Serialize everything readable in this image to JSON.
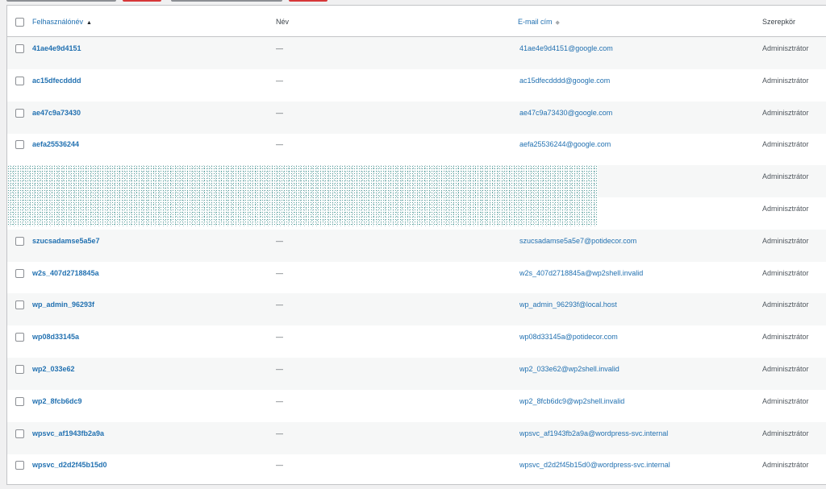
{
  "colors": {
    "link": "#2271b1",
    "danger": "#d63638",
    "border": "#c3c4c7",
    "alt_row": "#f6f7f7"
  },
  "header": {
    "username": "Felhasználónév",
    "name": "Név",
    "email": "E-mail cím",
    "role": "Szerepkör"
  },
  "rows": [
    {
      "username": "41ae4e9d4151",
      "name": "—",
      "email": "41ae4e9d4151@google.com",
      "role": "Adminisztrátor"
    },
    {
      "username": "ac15dfecdddd",
      "name": "—",
      "email": "ac15dfecdddd@google.com",
      "role": "Adminisztrátor"
    },
    {
      "username": "ae47c9a73430",
      "name": "—",
      "email": "ae47c9a73430@google.com",
      "role": "Adminisztrátor"
    },
    {
      "username": "aefa25536244",
      "name": "—",
      "email": "aefa25536244@google.com",
      "role": "Adminisztrátor"
    },
    {
      "username": "",
      "name": "",
      "email": "",
      "role": "Adminisztrátor"
    },
    {
      "username": "",
      "name": "",
      "email": "",
      "role": "Adminisztrátor"
    },
    {
      "username": "szucsadamse5a5e7",
      "name": "—",
      "email": "szucsadamse5a5e7@potidecor.com",
      "role": "Adminisztrátor"
    },
    {
      "username": "w2s_407d2718845a",
      "name": "—",
      "email": "w2s_407d2718845a@wp2shell.invalid",
      "role": "Adminisztrátor"
    },
    {
      "username": "wp_admin_96293f",
      "name": "—",
      "email": "wp_admin_96293f@local.host",
      "role": "Adminisztrátor"
    },
    {
      "username": "wp08d33145a",
      "name": "—",
      "email": "wp08d33145a@potidecor.com",
      "role": "Adminisztrátor"
    },
    {
      "username": "wp2_033e62",
      "name": "—",
      "email": "wp2_033e62@wp2shell.invalid",
      "role": "Adminisztrátor"
    },
    {
      "username": "wp2_8fcb6dc9",
      "name": "—",
      "email": "wp2_8fcb6dc9@wp2shell.invalid",
      "role": "Adminisztrátor"
    },
    {
      "username": "wpsvc_af1943fb2a9a",
      "name": "—",
      "email": "wpsvc_af1943fb2a9a@wordpress-svc.internal",
      "role": "Adminisztrátor"
    },
    {
      "username": "wpsvc_d2d2f45b15d0",
      "name": "—",
      "email": "wpsvc_d2d2f45b15d0@wordpress-svc.internal",
      "role": "Adminisztrátor"
    }
  ]
}
